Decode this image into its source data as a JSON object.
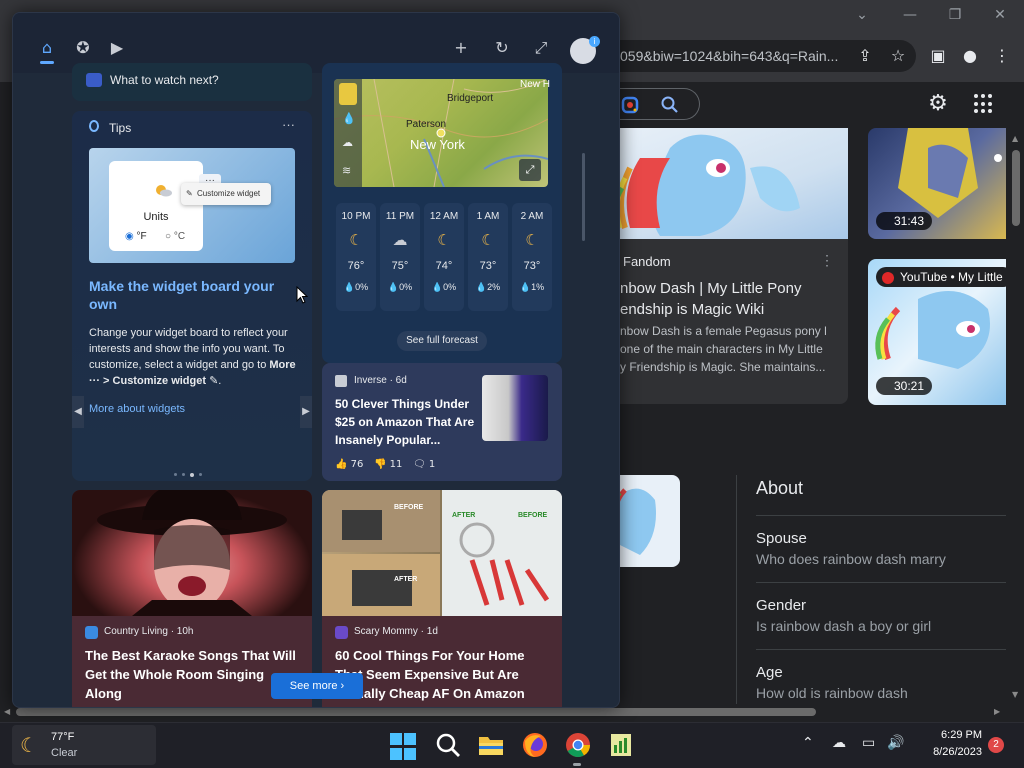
{
  "browser": {
    "url": "059&biw=1024&bih=643&q=Rain...",
    "fandom": {
      "source": "Fandom",
      "title": "nbow Dash | My Little Pony endship is Magic Wiki",
      "description": "nbow Dash is a female Pegasus pony l one of the main characters in My Little y Friendship is Magic. She maintains..."
    },
    "videos": [
      {
        "duration": "31:43"
      },
      {
        "badge": "YouTube • My Little",
        "duration": "30:21"
      }
    ],
    "about": {
      "title": "About",
      "items": [
        {
          "heading": "Spouse",
          "question": "Who does rainbow dash marry"
        },
        {
          "heading": "Gender",
          "question": "Is rainbow dash a boy or girl"
        },
        {
          "heading": "Age",
          "question": "How old is rainbow dash"
        }
      ]
    }
  },
  "widgets": {
    "watch": {
      "text": "What to watch next?"
    },
    "tips": {
      "label": "Tips",
      "more": "···",
      "illustration": {
        "units": "Units",
        "f": "°F",
        "c": "°C",
        "menu_item": "Customize widget",
        "dots": "···"
      },
      "title": "Make the widget board your own",
      "body": "Change your widget board to reflect your interests and show the info you want. To customize, select a widget and go to ",
      "body_bold": "More ··· > Customize widget",
      "link": "More about widgets"
    },
    "weather": {
      "map_labels": {
        "bridgeport": "Bridgeport",
        "paterson": "Paterson",
        "newyork": "New York",
        "newh": "New H"
      },
      "forecast": [
        {
          "time": "10 PM",
          "icon": "moon",
          "temp": "76°",
          "precip": "0%"
        },
        {
          "time": "11 PM",
          "icon": "cloudy-moon",
          "temp": "75°",
          "precip": "0%"
        },
        {
          "time": "12 AM",
          "icon": "moon",
          "temp": "74°",
          "precip": "0%"
        },
        {
          "time": "1 AM",
          "icon": "moon",
          "temp": "73°",
          "precip": "2%"
        },
        {
          "time": "2 AM",
          "icon": "moon",
          "temp": "73°",
          "precip": "1%"
        }
      ],
      "see_forecast": "See full forecast"
    },
    "inverse": {
      "source": "Inverse · 6d",
      "title": "50 Clever Things Under $25 on Amazon That Are Insanely Popular...",
      "likes": "76",
      "dislikes": "11",
      "comments": "1"
    },
    "karaoke": {
      "source": "Country Living · 10h",
      "title": "The Best Karaoke Songs That Will Get the Whole Room Singing Along"
    },
    "scary": {
      "source": "Scary Mommy · 1d",
      "title": "60 Cool Things For Your Home That Seem Expensive But Are Actually Cheap AF On Amazon",
      "before": "BEFORE",
      "after": "AFTER"
    },
    "see_more": "See more"
  },
  "taskbar": {
    "temp": "77°F",
    "condition": "Clear",
    "time": "6:29 PM",
    "date": "8/26/2023",
    "notifications": "2"
  }
}
